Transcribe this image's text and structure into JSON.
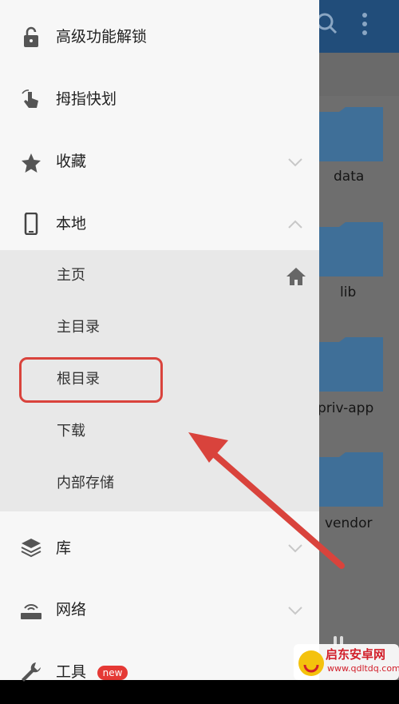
{
  "drawer": {
    "items": [
      {
        "label": "高级功能解锁",
        "icon": "lock-open-icon"
      },
      {
        "label": "拇指快划",
        "icon": "swipe-hand-icon"
      },
      {
        "label": "收藏",
        "icon": "star-icon"
      },
      {
        "label": "本地",
        "icon": "phone-icon"
      },
      {
        "label": "库",
        "icon": "layers-icon"
      },
      {
        "label": "网络",
        "icon": "router-icon"
      },
      {
        "label": "工具",
        "icon": "wrench-icon",
        "badge": "new"
      }
    ],
    "local_sub": [
      {
        "label": "主页"
      },
      {
        "label": "主目录"
      },
      {
        "label": "根目录"
      },
      {
        "label": "下载"
      },
      {
        "label": "内部存储"
      }
    ]
  },
  "background": {
    "folders": [
      {
        "label": "data"
      },
      {
        "label": "lib"
      },
      {
        "label": "priv-app"
      },
      {
        "label": "vendor"
      }
    ]
  },
  "watermark": {
    "text": "启东安卓网",
    "url": "www.qdltdq.com"
  },
  "colors": {
    "toolbar": "#214d7a",
    "folder": "#3f6f98",
    "highlight": "#d9433c",
    "badge": "#e53935"
  }
}
